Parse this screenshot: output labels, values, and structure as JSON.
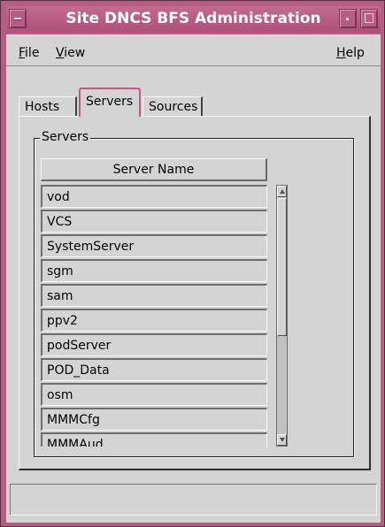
{
  "window": {
    "title": "Site DNCS BFS Administration"
  },
  "menubar": {
    "file": {
      "mnemonic": "F",
      "rest": "ile"
    },
    "view": {
      "mnemonic": "V",
      "rest": "iew"
    },
    "help": {
      "mnemonic": "H",
      "rest": "elp"
    }
  },
  "tabs": [
    {
      "label": "Hosts",
      "active": false
    },
    {
      "label": "Servers",
      "active": true
    },
    {
      "label": "Sources",
      "active": false
    }
  ],
  "servers": {
    "group_label": "Servers",
    "column_header": "Server Name",
    "rows": [
      "vod",
      "VCS",
      "SystemServer",
      "sgm",
      "sam",
      "ppv2",
      "podServer",
      "POD_Data",
      "osm",
      "MMMCfg",
      "MMMAud"
    ]
  },
  "status": {
    "text": ""
  },
  "colors": {
    "titlebar": "#b55e82",
    "background": "#d4d4d4",
    "active_tab_border": "#c05a85"
  }
}
